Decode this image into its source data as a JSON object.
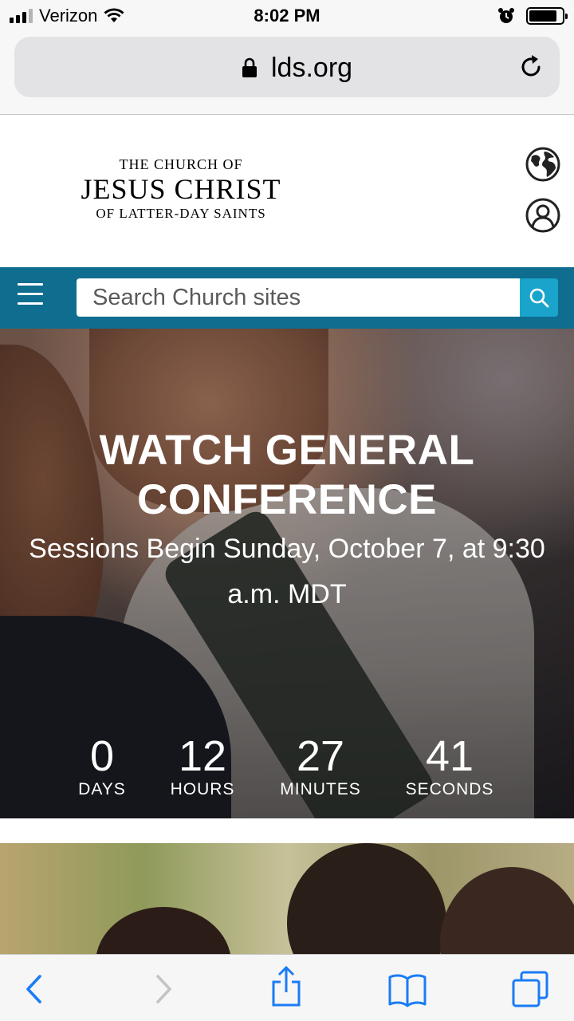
{
  "status_bar": {
    "carrier": "Verizon",
    "time": "8:02 PM",
    "battery_level": 0.85,
    "signal_bars": 3
  },
  "browser": {
    "url": "lds.org",
    "icons": [
      "lock-icon",
      "reload-icon",
      "back-icon",
      "forward-icon",
      "share-icon",
      "bookmarks-icon",
      "tabs-icon"
    ]
  },
  "header": {
    "logo_top": "THE CHURCH OF",
    "logo_main": "JESUS CHRIST",
    "logo_bottom": "OF LATTER-DAY SAINTS",
    "icons": [
      "globe-icon",
      "account-icon"
    ]
  },
  "nav": {
    "search_placeholder": "Search Church sites",
    "bar_color": "#0f6d8f",
    "search_button_color": "#1aa4cc"
  },
  "hero": {
    "title": "WATCH GENERAL CONFERENCE",
    "subtitle": "Sessions Begin Sunday, October 7, at 9:30 a.m. MDT",
    "countdown": [
      {
        "value": "0",
        "label": "DAYS"
      },
      {
        "value": "12",
        "label": "HOURS"
      },
      {
        "value": "27",
        "label": "MINUTES"
      },
      {
        "value": "41",
        "label": "SECONDS"
      }
    ]
  }
}
